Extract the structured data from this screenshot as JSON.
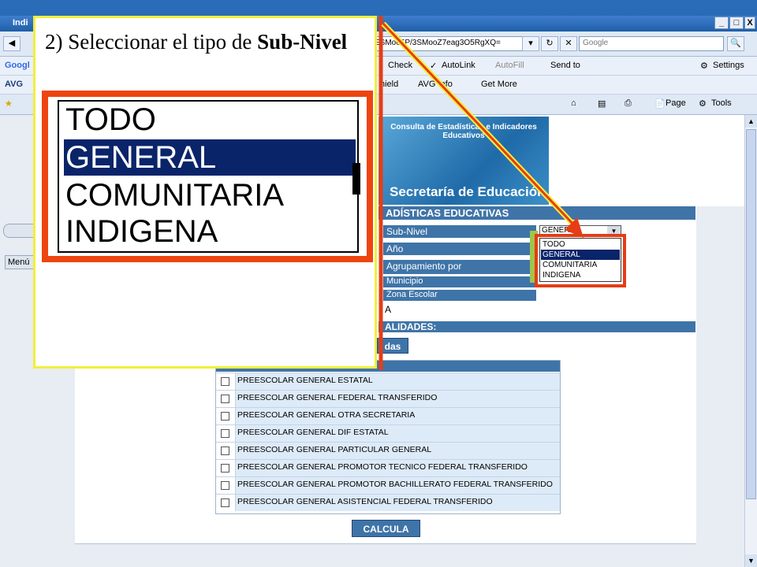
{
  "browser": {
    "title": "Indi",
    "address": "ESMoo5P/3SMooZ7eag3O5RgXQ=",
    "search_placeholder": "Google",
    "toolbar1": {
      "check": "Check",
      "autolink": "AutoLink",
      "autofill": "AutoFill",
      "sendto": "Send to",
      "settings": "Settings"
    },
    "toolbar2": {
      "shield": "hield",
      "avg_info": "AVG Info",
      "get_more": "Get More",
      "avg_logo": "AVG",
      "google_logo": "Googl"
    },
    "toolbar3": {
      "page": "Page",
      "tools": "Tools"
    },
    "window_buttons": [
      "_",
      "□",
      "X"
    ]
  },
  "page": {
    "left_menu": "Menú",
    "banner_title": "Consulta de Estadísticas e Indicadores Educativos",
    "banner_sub": "Secretaría de Educación",
    "form_header": "ADÍSTICAS EDUCATIVAS",
    "rows": [
      "Sub-Nivel",
      "Año",
      "Agrupamiento por",
      "Municipio",
      "Zona Escolar"
    ],
    "select_value": "GENERAL",
    "small_options": [
      "TODO",
      "GENERAL",
      "COMUNITARIA",
      "INDIGENA"
    ],
    "small_selected": 1,
    "mini_value": "A",
    "section_header": "ALIDADES:",
    "todas_button": "das",
    "options": [
      "PREESCOLAR GENERAL ESTATAL",
      "PREESCOLAR GENERAL FEDERAL TRANSFERIDO",
      "PREESCOLAR GENERAL OTRA SECRETARIA",
      "PREESCOLAR GENERAL DIF ESTATAL",
      "PREESCOLAR GENERAL PARTICULAR GENERAL",
      "PREESCOLAR GENERAL PROMOTOR TECNICO FEDERAL TRANSFERIDO",
      "PREESCOLAR GENERAL PROMOTOR BACHILLERATO FEDERAL TRANSFERIDO",
      "PREESCOLAR GENERAL ASISTENCIAL FEDERAL TRANSFERIDO"
    ],
    "calcula_button": "CALCULA"
  },
  "callout": {
    "step": "2) Seleccionar el tipo de ",
    "bold": "Sub-Nivel",
    "zoom_options": [
      "TODO",
      "GENERAL",
      "COMUNITARIA",
      "INDIGENA"
    ],
    "zoom_selected": 1
  },
  "colors": {
    "accent": "#3f74a8",
    "highlight_red": "#e53d15",
    "callout_border": "#f3ee3c",
    "selection": "#0a246a"
  }
}
